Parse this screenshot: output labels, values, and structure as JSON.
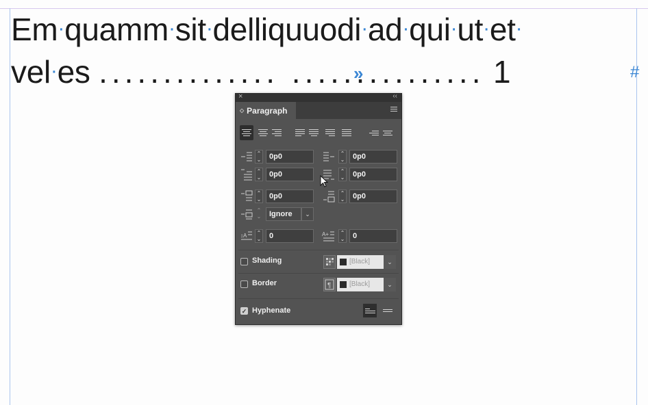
{
  "document": {
    "line1_words": [
      "Em",
      "quamm",
      "sit",
      "delliquuodi",
      "ad",
      "qui",
      "ut",
      "et"
    ],
    "line2_start": "vel",
    "line2_word": "es",
    "line2_end": "1"
  },
  "panel": {
    "title": "Paragraph",
    "left_indent": "0p0",
    "right_indent": "0p0",
    "first_line_indent": "0p0",
    "last_line_indent": "0p0",
    "space_before": "0p0",
    "space_after": "0p0",
    "align_to_grid": "Ignore",
    "drop_cap_lines": "0",
    "drop_cap_chars": "0",
    "shading_label": "Shading",
    "shading_color": "[Black]",
    "border_label": "Border",
    "border_color": "[Black]",
    "hyphenate_label": "Hyphenate",
    "shading_checked": false,
    "border_checked": false,
    "hyphenate_checked": true
  },
  "colors": {
    "hidden_char": "#3a86d4",
    "panel_bg": "#535353",
    "margin_guide": "#a9c4ee"
  }
}
